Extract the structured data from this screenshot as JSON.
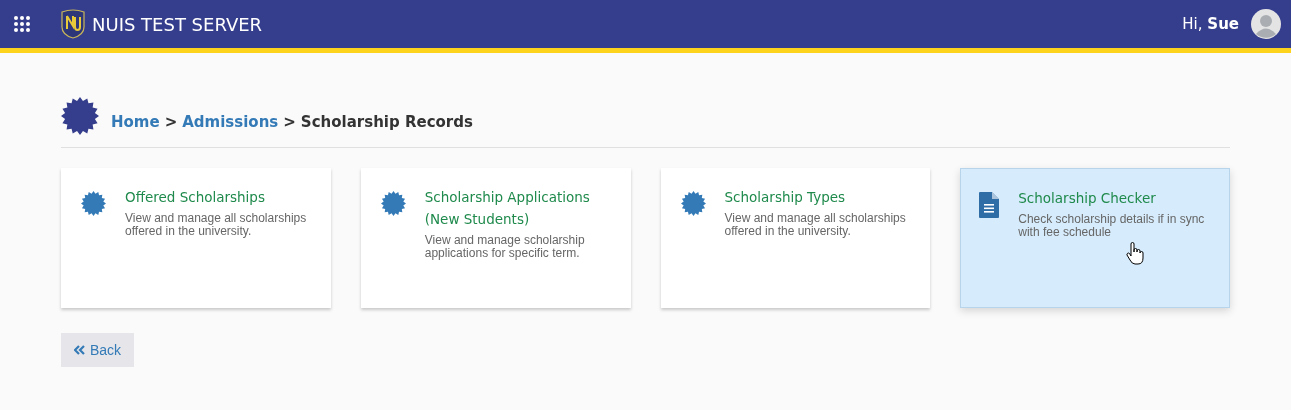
{
  "header": {
    "title": "NUIS TEST SERVER",
    "greeting": "Hi,",
    "user": "Sue"
  },
  "breadcrumb": [
    {
      "label": "Home",
      "kind": "link"
    },
    {
      "label": ">",
      "kind": "separator"
    },
    {
      "label": "Admissions",
      "kind": "link"
    },
    {
      "label": ">",
      "kind": "separator"
    },
    {
      "label": "Scholarship Records",
      "kind": "current"
    }
  ],
  "cards": [
    {
      "title": "Offered Scholarships",
      "description": "View and manage all scholarships offered in the university.",
      "kind": "badge",
      "hovered": false
    },
    {
      "title": "Scholarship Applications (New Students)",
      "description": "View and manage scholarship applications for specific term.",
      "kind": "badge",
      "hovered": false
    },
    {
      "title": "Scholarship Types",
      "description": "View and manage all scholarships offered in the university.",
      "kind": "badge",
      "hovered": false
    },
    {
      "title": "Scholarship Checker",
      "description": "Check scholarship details if in sync with fee schedule",
      "kind": "document",
      "hovered": true
    }
  ],
  "back_button": {
    "label": "Back"
  }
}
